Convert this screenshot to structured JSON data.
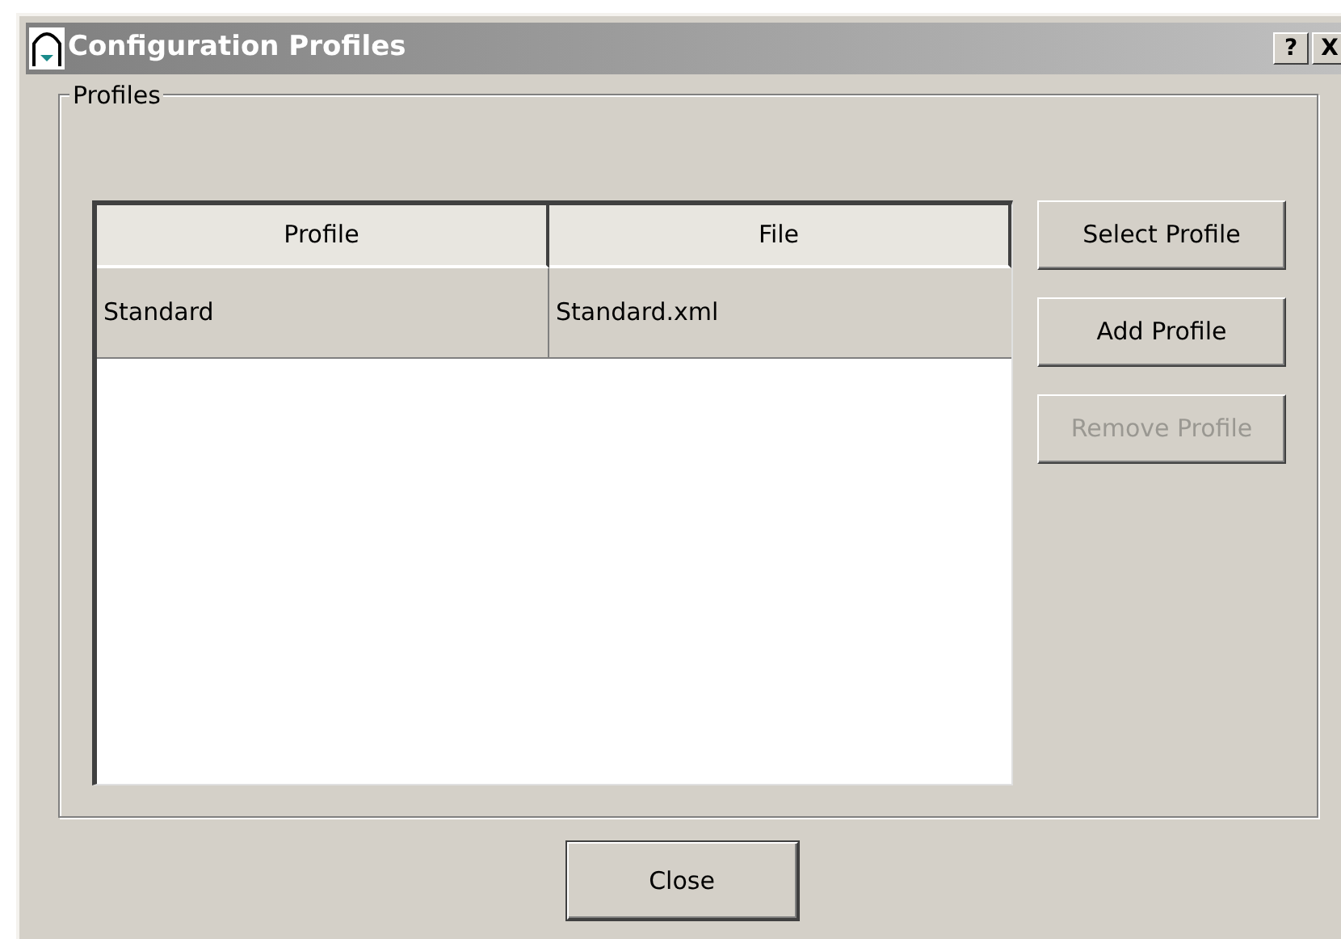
{
  "window": {
    "title": "Configuration Profiles",
    "title_buttons": [
      "?",
      "X"
    ]
  },
  "group": {
    "label": "Profiles"
  },
  "table": {
    "columns": [
      "Profile",
      "File"
    ],
    "rows": [
      {
        "cells": [
          "Standard",
          "Standard.xml"
        ],
        "selected": true
      }
    ]
  },
  "side_buttons": [
    {
      "label": "Select Profile",
      "disabled": false
    },
    {
      "label": "Add Profile",
      "disabled": false
    },
    {
      "label": "Remove Profile",
      "disabled": true
    }
  ],
  "footer_button": {
    "label": "Close"
  }
}
